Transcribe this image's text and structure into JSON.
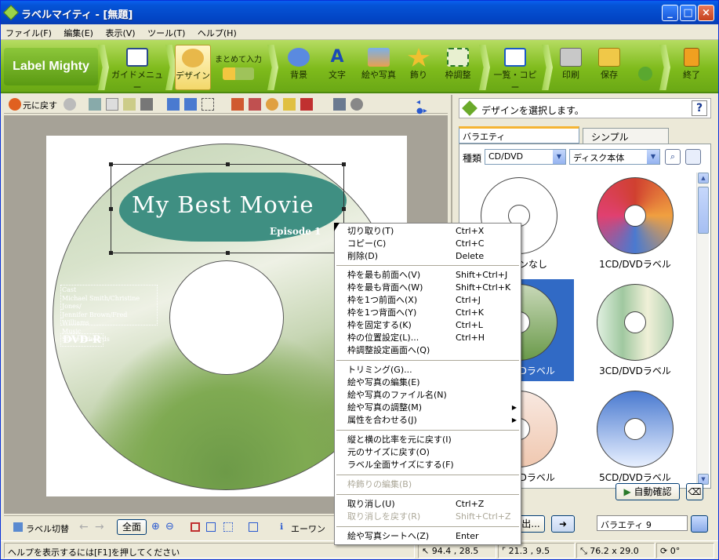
{
  "window": {
    "title": "ラベルマイティ - [無題]"
  },
  "menu": [
    "ファイル(F)",
    "編集(E)",
    "表示(V)",
    "ツール(T)",
    "ヘルプ(H)"
  ],
  "ribbon": {
    "logo": "Label Mighty",
    "buttons": [
      "ガイドメニュー",
      "デザイン",
      "まとめて入力",
      "背景",
      "文字",
      "絵や写真",
      "飾り",
      "枠調整",
      "一覧・コピー",
      "印刷",
      "保存",
      "終了"
    ]
  },
  "left_toolbar": {
    "undo": "元に戻す"
  },
  "design": {
    "title": "My Best Movie",
    "episode": "Episode 1",
    "credits": [
      "Cast",
      "Michael Smith/Christine Jones/",
      "Jennifer Brown/Fred Williams",
      "Music",
      "Steve Edwards"
    ],
    "format": "DVD-R"
  },
  "left_bottom": {
    "label_switch": "ラベル切替",
    "zoom_all": "全面",
    "eworn": "エーワン"
  },
  "right_panel": {
    "header": "デザインを選択します。",
    "help": "?",
    "tabs": [
      "バラエティ",
      "シンプル"
    ],
    "kind_label": "種類",
    "kind_value": "CD/DVD",
    "sub_value": "ディスク本体",
    "items": [
      "デザインなし",
      "1CD/DVDラベル",
      "2CD/DVDラベル",
      "3CD/DVDラベル",
      "4CD/DVDラベル",
      "5CD/DVDラベル"
    ],
    "auto_confirm": "自動確認",
    "export": "書出...",
    "variety_field": "バラエティ 9"
  },
  "context_menu": [
    {
      "label": "切り取り(T)",
      "shortcut": "Ctrl+X"
    },
    {
      "label": "コピー(C)",
      "shortcut": "Ctrl+C"
    },
    {
      "label": "削除(D)",
      "shortcut": "Delete"
    },
    {
      "label": "枠を最も前面へ(V)",
      "shortcut": "Shift+Ctrl+J"
    },
    {
      "label": "枠を最も背面へ(W)",
      "shortcut": "Shift+Ctrl+K"
    },
    {
      "label": "枠を1つ前面へ(X)",
      "shortcut": "Ctrl+J"
    },
    {
      "label": "枠を1つ背面へ(Y)",
      "shortcut": "Ctrl+K"
    },
    {
      "label": "枠を固定する(K)",
      "shortcut": "Ctrl+L"
    },
    {
      "label": "枠の位置設定(L)...",
      "shortcut": "Ctrl+H"
    },
    {
      "label": "枠調整設定画面へ(Q)",
      "shortcut": ""
    },
    {
      "label": "トリミング(G)...",
      "shortcut": ""
    },
    {
      "label": "絵や写真の編集(E)",
      "shortcut": ""
    },
    {
      "label": "絵や写真のファイル名(N)",
      "shortcut": ""
    },
    {
      "label": "絵や写真の調整(M)",
      "shortcut": ""
    },
    {
      "label": "属性を合わせる(J)",
      "shortcut": ""
    },
    {
      "label": "縦と横の比率を元に戻す(I)",
      "shortcut": ""
    },
    {
      "label": "元のサイズに戻す(O)",
      "shortcut": ""
    },
    {
      "label": "ラベル全面サイズにする(F)",
      "shortcut": ""
    },
    {
      "label": "枠飾りの編集(B)",
      "shortcut": ""
    },
    {
      "label": "取り消し(U)",
      "shortcut": "Ctrl+Z"
    },
    {
      "label": "取り消しを戻す(R)",
      "shortcut": "Shift+Ctrl+Z"
    },
    {
      "label": "絵や写真シートへ(Z)",
      "shortcut": "Enter"
    }
  ],
  "status": {
    "help": "ヘルプを表示するには[F1]を押してください",
    "pos": "94.4 , 28.5",
    "offset": "21.3 , 9.5",
    "size": "76.2 x 29.0",
    "angle": "0°"
  },
  "colors": {
    "ribbon": "#7fbb1c",
    "titlebar": "#0244c4",
    "banner": "#3f8f82",
    "selection": "#316ac5"
  }
}
